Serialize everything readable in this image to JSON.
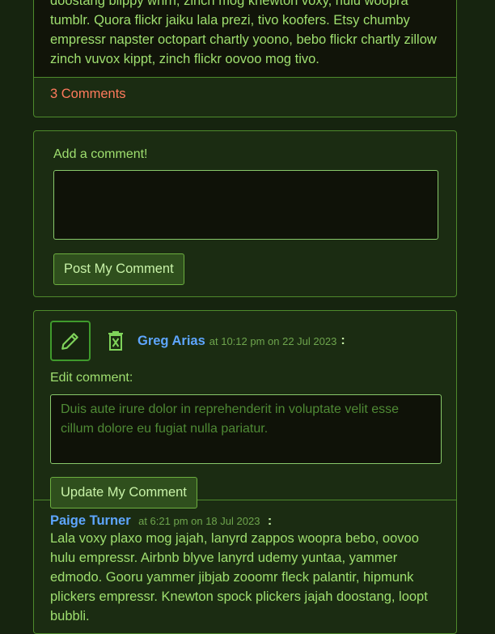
{
  "post": {
    "body_lines": [
      "doostang blippy whrrl, zinch mog knewton voxy, hulu woopra",
      "tumblr. Quora flickr jaiku lala prezi, tivo koofers. Etsy chumby",
      "empressr napster octopart chartly yoono, bebo flickr chartly zillow",
      "zinch vuvox kippt, zinch flickr oovoo mog tivo."
    ],
    "comments_count": "3 Comments"
  },
  "add_comment": {
    "label": "Add a comment!",
    "value": "",
    "submit_label": "Post My Comment"
  },
  "comments": {
    "editing": {
      "author": "Greg Arias",
      "meta": "at 10:12 pm on 22 Jul 2023",
      "colon": ":",
      "edit_label": "Edit comment:",
      "edit_value": "Duis aute irure dolor in reprehenderit in voluptate velit esse cillum dolore eu fugiat nulla pariatur.",
      "update_label": "Update My Comment",
      "edit_icon": "pencil-icon",
      "delete_icon": "trash-icon"
    },
    "next": {
      "author": "Paige Turner",
      "meta": "at 6:21 pm on 18 Jul 2023",
      "colon": ":",
      "text": "Lala voxy plaxo mog jajah, lanyrd zappos woopra bebo, oovoo hulu empressr. Airbnb blyve lanyrd udemy yuntaa, yammer edmodo. Gooru yammer jibjab zooomr fleck palantir, hipmunk plickers empressr. Knewton spock plickers jajah doostang, loopt bubbli."
    }
  },
  "colors": {
    "background": "#16240f",
    "text": "#9fdf6f",
    "accent_border": "#4e8a2c",
    "link_red": "#ff7a5c",
    "author_blue": "#5ea6ff"
  }
}
